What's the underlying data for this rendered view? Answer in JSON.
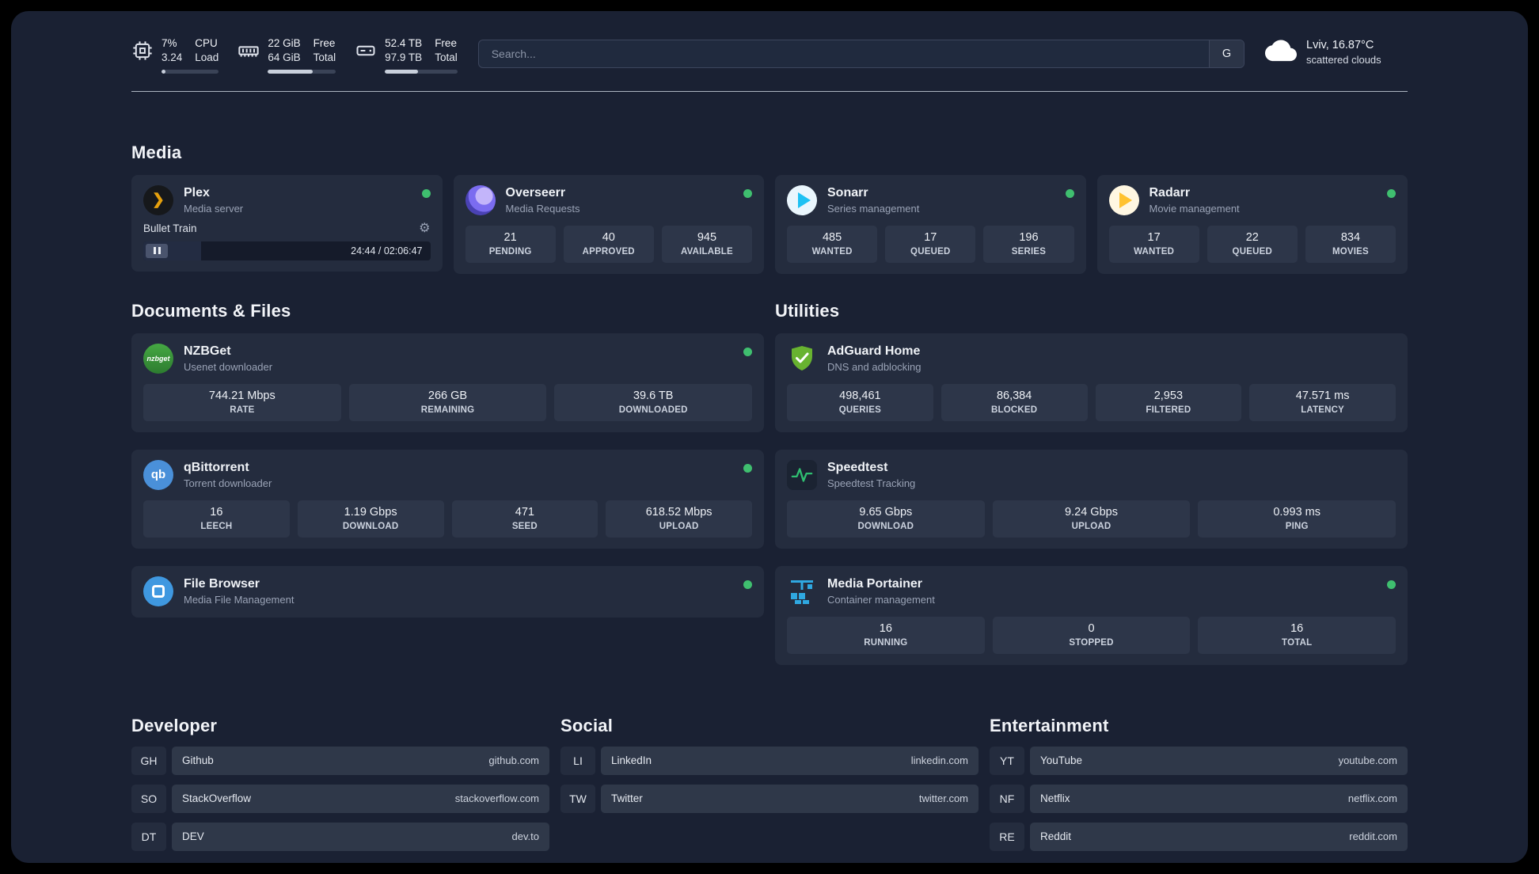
{
  "topbar": {
    "monitors": [
      {
        "icon": "cpu",
        "value_top": "7%",
        "value_bottom": "3.24",
        "label_top": "CPU",
        "label_bottom": "Load",
        "progress": 7
      },
      {
        "icon": "ram",
        "value_top": "22 GiB",
        "value_bottom": "64 GiB",
        "label_top": "Free",
        "label_bottom": "Total",
        "progress": 66
      },
      {
        "icon": "disk",
        "value_top": "52.4 TB",
        "value_bottom": "97.9 TB",
        "label_top": "Free",
        "label_bottom": "Total",
        "progress": 46
      }
    ],
    "search": {
      "placeholder": "Search...",
      "engine_label": "G"
    },
    "weather": {
      "location": "Lviv, 16.87°C",
      "condition": "scattered clouds"
    }
  },
  "sections": {
    "media": {
      "title": "Media"
    },
    "documents": {
      "title": "Documents & Files"
    },
    "utilities": {
      "title": "Utilities"
    },
    "developer": {
      "title": "Developer"
    },
    "social": {
      "title": "Social"
    },
    "entertainment": {
      "title": "Entertainment"
    }
  },
  "apps": {
    "plex": {
      "name": "Plex",
      "subtitle": "Media server",
      "now_playing": "Bullet Train",
      "time": "24:44 / 02:06:47",
      "progress": 20
    },
    "overseerr": {
      "name": "Overseerr",
      "subtitle": "Media Requests",
      "stats": [
        {
          "value": "21",
          "label": "PENDING"
        },
        {
          "value": "40",
          "label": "APPROVED"
        },
        {
          "value": "945",
          "label": "AVAILABLE"
        }
      ]
    },
    "sonarr": {
      "name": "Sonarr",
      "subtitle": "Series management",
      "stats": [
        {
          "value": "485",
          "label": "WANTED"
        },
        {
          "value": "17",
          "label": "QUEUED"
        },
        {
          "value": "196",
          "label": "SERIES"
        }
      ]
    },
    "radarr": {
      "name": "Radarr",
      "subtitle": "Movie management",
      "stats": [
        {
          "value": "17",
          "label": "WANTED"
        },
        {
          "value": "22",
          "label": "QUEUED"
        },
        {
          "value": "834",
          "label": "MOVIES"
        }
      ]
    },
    "nzbget": {
      "name": "NZBGet",
      "subtitle": "Usenet downloader",
      "icon_text": "nzbget",
      "stats": [
        {
          "value": "744.21 Mbps",
          "label": "RATE"
        },
        {
          "value": "266 GB",
          "label": "REMAINING"
        },
        {
          "value": "39.6 TB",
          "label": "DOWNLOADED"
        }
      ]
    },
    "qbittorrent": {
      "name": "qBittorrent",
      "subtitle": "Torrent downloader",
      "icon_text": "qb",
      "stats": [
        {
          "value": "16",
          "label": "LEECH"
        },
        {
          "value": "1.19 Gbps",
          "label": "DOWNLOAD"
        },
        {
          "value": "471",
          "label": "SEED"
        },
        {
          "value": "618.52 Mbps",
          "label": "UPLOAD"
        }
      ]
    },
    "filebrowser": {
      "name": "File Browser",
      "subtitle": "Media File Management"
    },
    "adguard": {
      "name": "AdGuard Home",
      "subtitle": "DNS and adblocking",
      "stats": [
        {
          "value": "498,461",
          "label": "QUERIES"
        },
        {
          "value": "86,384",
          "label": "BLOCKED"
        },
        {
          "value": "2,953",
          "label": "FILTERED"
        },
        {
          "value": "47.571 ms",
          "label": "LATENCY"
        }
      ]
    },
    "speedtest": {
      "name": "Speedtest",
      "subtitle": "Speedtest Tracking",
      "stats": [
        {
          "value": "9.65 Gbps",
          "label": "DOWNLOAD"
        },
        {
          "value": "9.24 Gbps",
          "label": "UPLOAD"
        },
        {
          "value": "0.993 ms",
          "label": "PING"
        }
      ]
    },
    "portainer": {
      "name": "Media Portainer",
      "subtitle": "Container management",
      "stats": [
        {
          "value": "16",
          "label": "RUNNING"
        },
        {
          "value": "0",
          "label": "STOPPED"
        },
        {
          "value": "16",
          "label": "TOTAL"
        }
      ]
    }
  },
  "bookmarks": {
    "developer": [
      {
        "abbr": "GH",
        "name": "Github",
        "url": "github.com"
      },
      {
        "abbr": "SO",
        "name": "StackOverflow",
        "url": "stackoverflow.com"
      },
      {
        "abbr": "DT",
        "name": "DEV",
        "url": "dev.to"
      }
    ],
    "social": [
      {
        "abbr": "LI",
        "name": "LinkedIn",
        "url": "linkedin.com"
      },
      {
        "abbr": "TW",
        "name": "Twitter",
        "url": "twitter.com"
      }
    ],
    "entertainment": [
      {
        "abbr": "YT",
        "name": "YouTube",
        "url": "youtube.com"
      },
      {
        "abbr": "NF",
        "name": "Netflix",
        "url": "netflix.com"
      },
      {
        "abbr": "RE",
        "name": "Reddit",
        "url": "reddit.com"
      }
    ]
  },
  "colors": {
    "status_online": "#3fbf6f",
    "plex_orange": "#e5a00d",
    "sonarr_blue": "#1ec1f3",
    "radarr_yellow": "#ffc230",
    "nzbget_green": "#3fa23f",
    "qbittorrent_blue": "#4a90d9",
    "filebrowser_blue": "#3f98e0",
    "adguard_green": "#68b330",
    "speedtest_green": "#2fbf71",
    "portainer_blue": "#2fa8e1",
    "overseerr_purple": "#7b6cf0"
  }
}
